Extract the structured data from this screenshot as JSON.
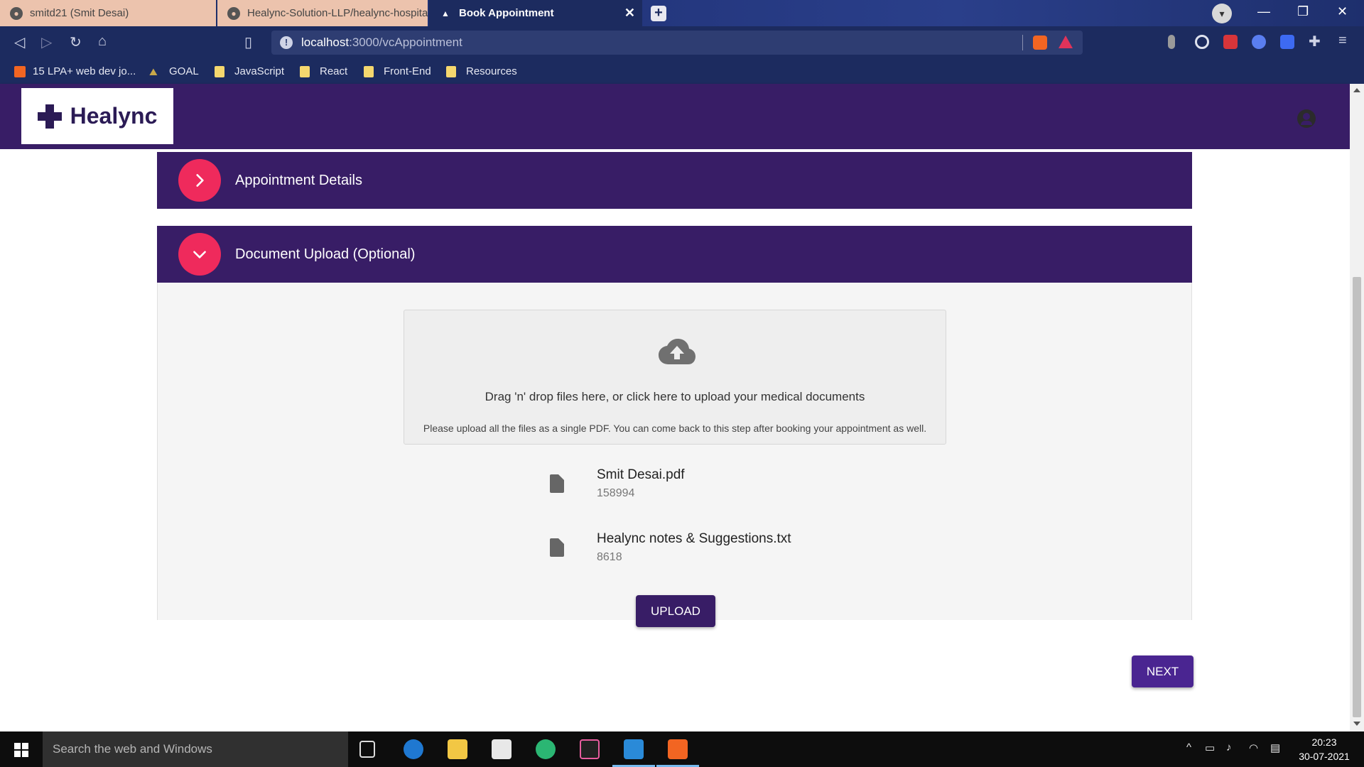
{
  "browser": {
    "tabs": [
      {
        "label": "smitd21 (Smit Desai)",
        "state": "inactive"
      },
      {
        "label": "Healync-Solution-LLP/healync-hospita",
        "state": "inactive"
      },
      {
        "label": "Book Appointment",
        "state": "active"
      }
    ],
    "url_host": "localhost",
    "url_path": ":3000/vcAppointment",
    "bookmarks": [
      "15 LPA+ web dev jo...",
      "GOAL",
      "JavaScript",
      "React",
      "Front-End",
      "Resources"
    ]
  },
  "app": {
    "logo_text": "Healync",
    "sections": [
      {
        "title": "Appointment Details",
        "expanded": false
      },
      {
        "title": "Document Upload (Optional)",
        "expanded": true
      }
    ],
    "dropzone": {
      "main_text": "Drag 'n' drop files here, or click here to upload your medical documents",
      "sub_text": "Please upload all the files as a single PDF. You can come back to this step after booking your appointment as well."
    },
    "files": [
      {
        "name": "Smit Desai.pdf",
        "size": "158994"
      },
      {
        "name": "Healync notes & Suggestions.txt",
        "size": "8618"
      }
    ],
    "upload_label": "UPLOAD",
    "next_label": "NEXT"
  },
  "taskbar": {
    "search_placeholder": "Search the web and Windows",
    "time": "20:23",
    "date": "30-07-2021"
  },
  "colors": {
    "primary": "#381d66",
    "accent": "#ef2a5c",
    "next_button": "#4a2591"
  }
}
